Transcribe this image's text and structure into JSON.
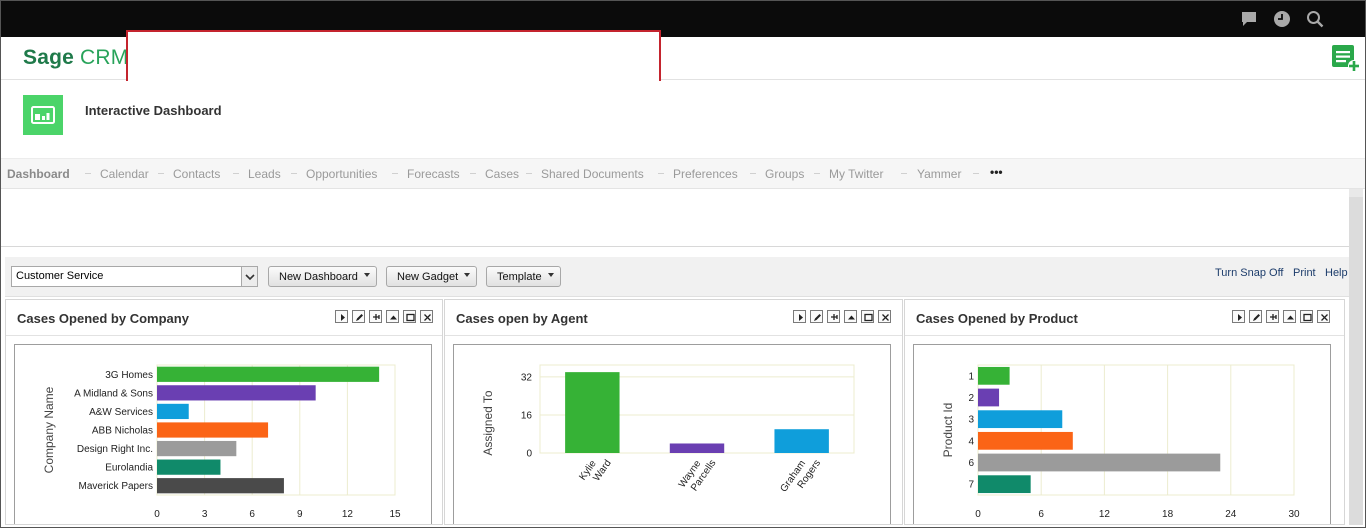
{
  "header": {
    "logo_sage": "Sage",
    "logo_crm": "CRM",
    "icons": [
      "chat-icon",
      "clock-icon",
      "search-icon",
      "add-list-icon"
    ]
  },
  "page": {
    "title": "Interactive Dashboard"
  },
  "nav": {
    "items": [
      "Dashboard",
      "Calendar",
      "Contacts",
      "Leads",
      "Opportunities",
      "Forecasts",
      "Cases",
      "Shared Documents",
      "Preferences",
      "Groups",
      "My Twitter",
      "Yammer",
      "•••"
    ],
    "active": "Dashboard"
  },
  "toolbar": {
    "dashboard_select": "Customer Service",
    "new_dashboard": "New Dashboard",
    "new_gadget": "New Gadget",
    "template": "Template",
    "snap": "Turn Snap Off",
    "print": "Print",
    "help": "Help"
  },
  "colors": {
    "green": "#36b236",
    "purple": "#6a3fb2",
    "blue": "#0f9edb",
    "orange": "#fb6416",
    "gray": "#9b9b9b",
    "teal": "#108a6a",
    "dark": "#4a4a4a"
  },
  "gadgets": {
    "company": {
      "title": "Cases Opened by Company"
    },
    "agent": {
      "title": "Cases open by Agent"
    },
    "product": {
      "title": "Cases Opened by Product"
    }
  },
  "chart_data": [
    {
      "type": "bar",
      "orientation": "horizontal",
      "title": "",
      "ylabel": "Company Name",
      "xlabel": "",
      "categories": [
        "3G Homes",
        "A Midland & Sons",
        "A&W Services",
        "ABB Nicholas",
        "Design Right Inc.",
        "Eurolandia",
        "Maverick Papers"
      ],
      "values": [
        14,
        10,
        2,
        7,
        5,
        4,
        8
      ],
      "colors": [
        "#36b236",
        "#6a3fb2",
        "#0f9edb",
        "#fb6416",
        "#9b9b9b",
        "#108a6a",
        "#4a4a4a"
      ],
      "xticks": [
        "0",
        "3",
        "6",
        "9",
        "12",
        "15"
      ],
      "xlim": [
        0,
        15
      ]
    },
    {
      "type": "bar",
      "orientation": "vertical",
      "title": "",
      "ylabel": "Assigned To",
      "xlabel": "",
      "categories": [
        "Kylie Ward",
        "Wayne Parcells",
        "Graham Rogers"
      ],
      "values": [
        34,
        4,
        10
      ],
      "colors": [
        "#36b236",
        "#6a3fb2",
        "#0f9edb"
      ],
      "yticks": [
        "0",
        "16",
        "32"
      ],
      "ylim": [
        0,
        37
      ]
    },
    {
      "type": "bar",
      "orientation": "horizontal",
      "title": "",
      "ylabel": "Product Id",
      "xlabel": "",
      "categories": [
        "1",
        "2",
        "3",
        "4",
        "6",
        "7"
      ],
      "values": [
        3,
        2,
        8,
        9,
        23,
        5
      ],
      "colors": [
        "#36b236",
        "#6a3fb2",
        "#0f9edb",
        "#fb6416",
        "#9b9b9b",
        "#108a6a"
      ],
      "xticks": [
        "0",
        "6",
        "12",
        "18",
        "24",
        "30"
      ],
      "xlim": [
        0,
        30
      ]
    }
  ]
}
